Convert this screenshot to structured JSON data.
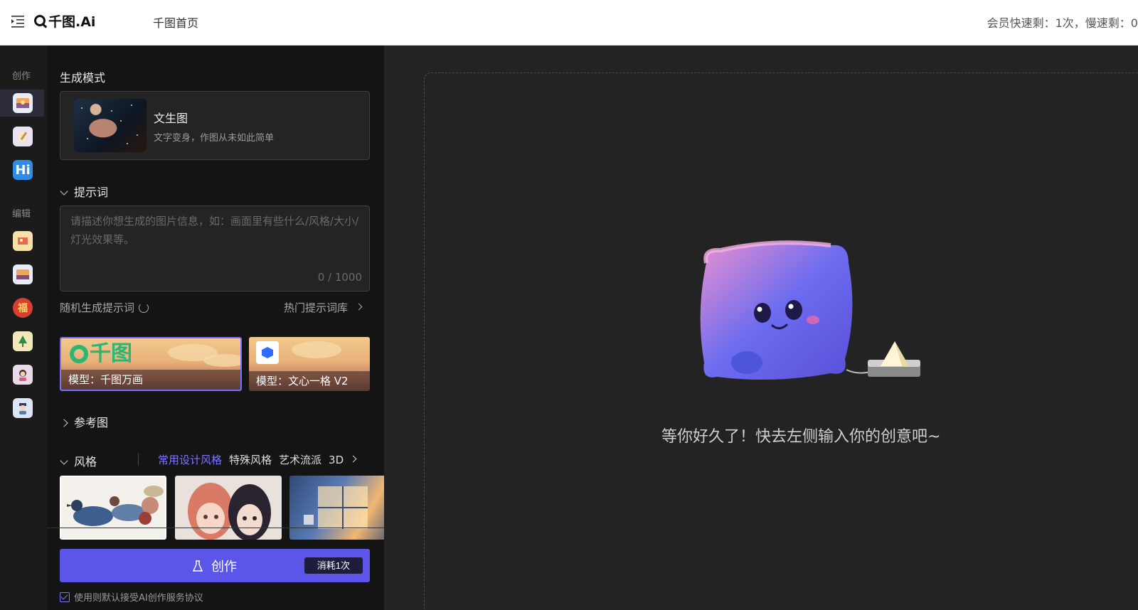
{
  "topbar": {
    "logo": "千图.Ai",
    "home_link": "千图首页",
    "quota": "会员快速剩：1次，慢速剩：0"
  },
  "rail": {
    "create_label": "创作",
    "edit_label": "编辑",
    "create_items": [
      {
        "icon": "text-to-image-icon",
        "glyph": "🌅",
        "active": true
      },
      {
        "icon": "sketch-icon",
        "glyph": "📝",
        "active": false
      },
      {
        "icon": "hi-text-icon",
        "glyph": "Hi",
        "active": false
      }
    ],
    "edit_items": [
      {
        "icon": "photo-edit-icon",
        "glyph": "🖼"
      },
      {
        "icon": "sunset-image-icon",
        "glyph": "🌇"
      },
      {
        "icon": "fortune-icon",
        "glyph": "福"
      },
      {
        "icon": "tree-icon",
        "glyph": "🌲"
      },
      {
        "icon": "portrait-icon",
        "glyph": "👩"
      },
      {
        "icon": "avatar-icon",
        "glyph": "🧒"
      }
    ]
  },
  "panel": {
    "mode_section": "生成模式",
    "mode_card": {
      "title": "文生图",
      "desc": "文字变身，作图从未如此简单"
    },
    "prompt_section": "提示词",
    "prompt_placeholder": "请描述你想生成的图片信息，如：画面里有些什么/风格/大小/灯光效果等。",
    "prompt_value": "",
    "prompt_counter": "0 / 1000",
    "random_prompt": "随机生成提示词",
    "hot_prompts": "热门提示词库",
    "models": [
      {
        "label": "模型：千图万画",
        "selected": true,
        "brand": "千图"
      },
      {
        "label": "模型：文心一格 V2",
        "selected": false
      }
    ],
    "reference_section": "参考图",
    "style_section": "风格",
    "style_tabs": [
      {
        "label": "常用设计风格",
        "active": true
      },
      {
        "label": "特殊风格",
        "active": false
      },
      {
        "label": "艺术流派",
        "active": false
      },
      {
        "label": "3D",
        "active": false
      }
    ],
    "create_button": "创作",
    "cost_badge": "消耗1次",
    "agreement": "使用则默认接受AI创作服务协议"
  },
  "canvas": {
    "empty_message": "等你好久了！快去左侧输入你的创意吧~"
  },
  "colors": {
    "accent": "#5b55e8",
    "accent_text": "#7c74ff",
    "panel_bg": "#141414",
    "canvas_bg": "#232323"
  }
}
